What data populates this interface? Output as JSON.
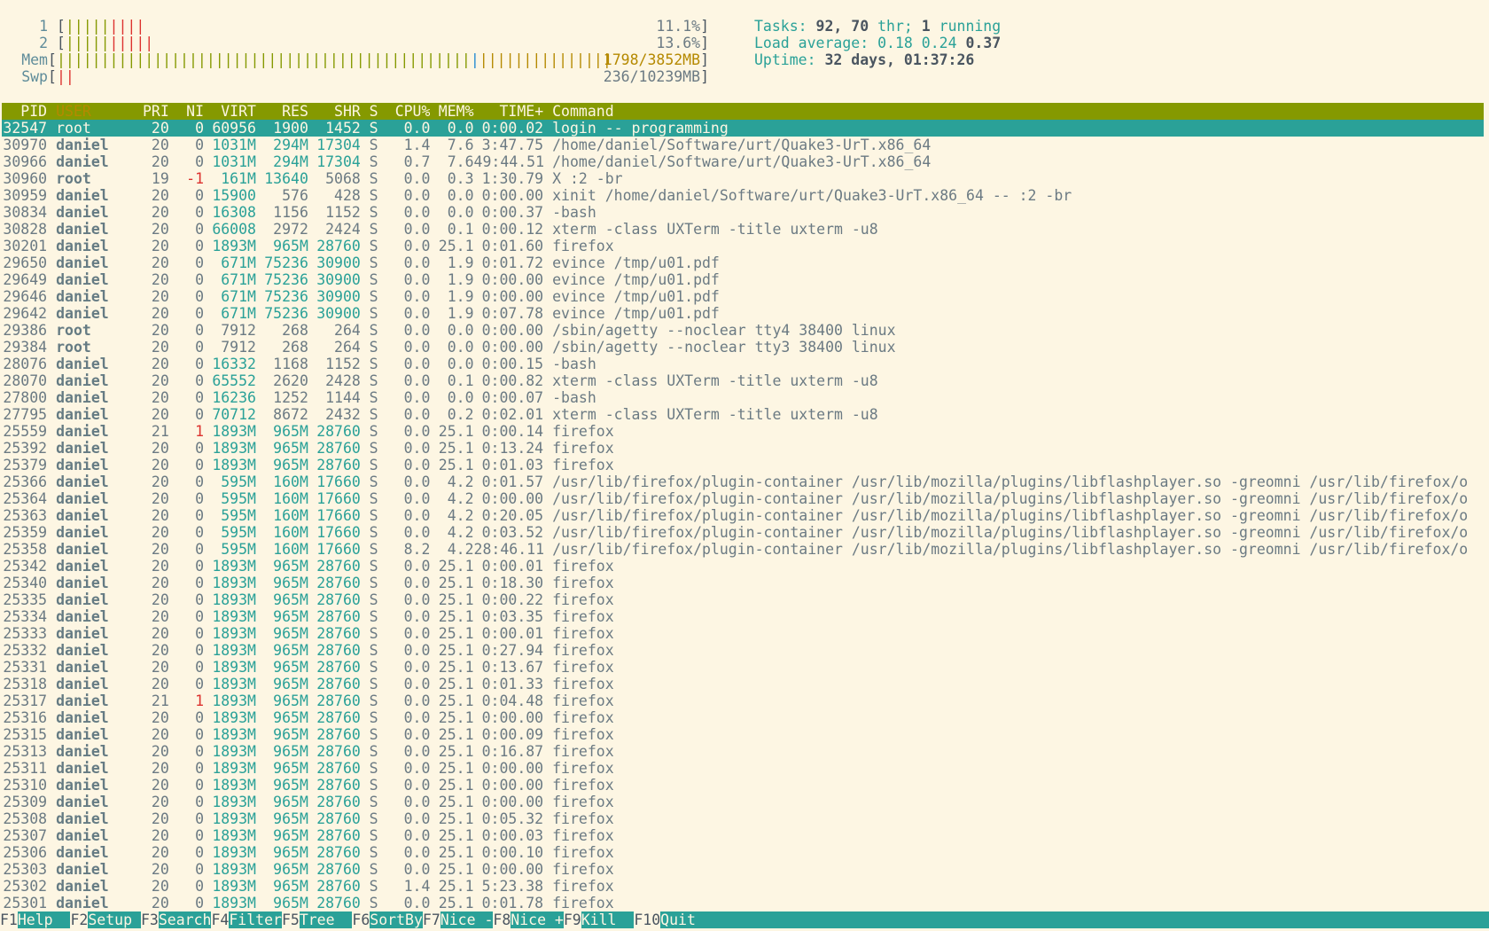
{
  "meters": {
    "cpu1": {
      "label": "1",
      "bars": "|||||||||",
      "value": "11.1%"
    },
    "cpu2": {
      "label": "2",
      "bars": "||||||||||",
      "value": "13.6%"
    },
    "mem": {
      "label": "Mem",
      "value": "1798/3852MB"
    },
    "swp": {
      "label": "Swp",
      "bars": "||",
      "value": "236/10239MB"
    }
  },
  "info": {
    "tasks_label": "Tasks: ",
    "tasks_value": "92, 70",
    "tasks_thr": " thr; ",
    "tasks_running": "1",
    "tasks_running_label": " running",
    "load_label": "Load average: ",
    "load_1": "0.18",
    "load_5": "0.24",
    "load_15": "0.37",
    "uptime_label": "Uptime: ",
    "uptime_value": "32 days, 01:37:26"
  },
  "columns": [
    "PID",
    "USER",
    "PRI",
    "NI",
    "VIRT",
    "RES",
    "SHR",
    "S",
    "CPU%",
    "MEM%",
    "TIME+",
    "Command"
  ],
  "processes": [
    [
      "32547",
      "root",
      "20",
      "0",
      "60956",
      "1900",
      "1452",
      "S",
      "0.0",
      "0.0",
      "0:00.02",
      "login -- programming"
    ],
    [
      "30970",
      "daniel",
      "20",
      "0",
      "1031M",
      "294M",
      "17304",
      "S",
      "1.4",
      "7.6",
      "3:47.75",
      "/home/daniel/Software/urt/Quake3-UrT.x86_64"
    ],
    [
      "30966",
      "daniel",
      "20",
      "0",
      "1031M",
      "294M",
      "17304",
      "S",
      "0.7",
      "7.6",
      "49:44.51",
      "/home/daniel/Software/urt/Quake3-UrT.x86_64"
    ],
    [
      "30960",
      "root",
      "19",
      "-1",
      "161M",
      "13640",
      "5068",
      "S",
      "0.0",
      "0.3",
      "1:30.79",
      "X :2 -br"
    ],
    [
      "30959",
      "daniel",
      "20",
      "0",
      "15900",
      "576",
      "428",
      "S",
      "0.0",
      "0.0",
      "0:00.00",
      "xinit /home/daniel/Software/urt/Quake3-UrT.x86_64 -- :2 -br"
    ],
    [
      "30834",
      "daniel",
      "20",
      "0",
      "16308",
      "1156",
      "1152",
      "S",
      "0.0",
      "0.0",
      "0:00.37",
      "-bash"
    ],
    [
      "30828",
      "daniel",
      "20",
      "0",
      "66008",
      "2972",
      "2424",
      "S",
      "0.0",
      "0.1",
      "0:00.12",
      "xterm -class UXTerm -title uxterm -u8"
    ],
    [
      "30201",
      "daniel",
      "20",
      "0",
      "1893M",
      "965M",
      "28760",
      "S",
      "0.0",
      "25.1",
      "0:01.60",
      "firefox"
    ],
    [
      "29650",
      "daniel",
      "20",
      "0",
      "671M",
      "75236",
      "30900",
      "S",
      "0.0",
      "1.9",
      "0:01.72",
      "evince /tmp/u01.pdf"
    ],
    [
      "29649",
      "daniel",
      "20",
      "0",
      "671M",
      "75236",
      "30900",
      "S",
      "0.0",
      "1.9",
      "0:00.00",
      "evince /tmp/u01.pdf"
    ],
    [
      "29646",
      "daniel",
      "20",
      "0",
      "671M",
      "75236",
      "30900",
      "S",
      "0.0",
      "1.9",
      "0:00.00",
      "evince /tmp/u01.pdf"
    ],
    [
      "29642",
      "daniel",
      "20",
      "0",
      "671M",
      "75236",
      "30900",
      "S",
      "0.0",
      "1.9",
      "0:07.78",
      "evince /tmp/u01.pdf"
    ],
    [
      "29386",
      "root",
      "20",
      "0",
      "7912",
      "268",
      "264",
      "S",
      "0.0",
      "0.0",
      "0:00.00",
      "/sbin/agetty --noclear tty4 38400 linux"
    ],
    [
      "29384",
      "root",
      "20",
      "0",
      "7912",
      "268",
      "264",
      "S",
      "0.0",
      "0.0",
      "0:00.00",
      "/sbin/agetty --noclear tty3 38400 linux"
    ],
    [
      "28076",
      "daniel",
      "20",
      "0",
      "16332",
      "1168",
      "1152",
      "S",
      "0.0",
      "0.0",
      "0:00.15",
      "-bash"
    ],
    [
      "28070",
      "daniel",
      "20",
      "0",
      "65552",
      "2620",
      "2428",
      "S",
      "0.0",
      "0.1",
      "0:00.82",
      "xterm -class UXTerm -title uxterm -u8"
    ],
    [
      "27800",
      "daniel",
      "20",
      "0",
      "16236",
      "1252",
      "1144",
      "S",
      "0.0",
      "0.0",
      "0:00.07",
      "-bash"
    ],
    [
      "27795",
      "daniel",
      "20",
      "0",
      "70712",
      "8672",
      "2432",
      "S",
      "0.0",
      "0.2",
      "0:02.01",
      "xterm -class UXTerm -title uxterm -u8"
    ],
    [
      "25559",
      "daniel",
      "21",
      "1",
      "1893M",
      "965M",
      "28760",
      "S",
      "0.0",
      "25.1",
      "0:00.14",
      "firefox"
    ],
    [
      "25392",
      "daniel",
      "20",
      "0",
      "1893M",
      "965M",
      "28760",
      "S",
      "0.0",
      "25.1",
      "0:13.24",
      "firefox"
    ],
    [
      "25379",
      "daniel",
      "20",
      "0",
      "1893M",
      "965M",
      "28760",
      "S",
      "0.0",
      "25.1",
      "0:01.03",
      "firefox"
    ],
    [
      "25366",
      "daniel",
      "20",
      "0",
      "595M",
      "160M",
      "17660",
      "S",
      "0.0",
      "4.2",
      "0:01.57",
      "/usr/lib/firefox/plugin-container /usr/lib/mozilla/plugins/libflashplayer.so -greomni /usr/lib/firefox/o"
    ],
    [
      "25364",
      "daniel",
      "20",
      "0",
      "595M",
      "160M",
      "17660",
      "S",
      "0.0",
      "4.2",
      "0:00.00",
      "/usr/lib/firefox/plugin-container /usr/lib/mozilla/plugins/libflashplayer.so -greomni /usr/lib/firefox/o"
    ],
    [
      "25363",
      "daniel",
      "20",
      "0",
      "595M",
      "160M",
      "17660",
      "S",
      "0.0",
      "4.2",
      "0:20.05",
      "/usr/lib/firefox/plugin-container /usr/lib/mozilla/plugins/libflashplayer.so -greomni /usr/lib/firefox/o"
    ],
    [
      "25359",
      "daniel",
      "20",
      "0",
      "595M",
      "160M",
      "17660",
      "S",
      "0.0",
      "4.2",
      "0:03.52",
      "/usr/lib/firefox/plugin-container /usr/lib/mozilla/plugins/libflashplayer.so -greomni /usr/lib/firefox/o"
    ],
    [
      "25358",
      "daniel",
      "20",
      "0",
      "595M",
      "160M",
      "17660",
      "S",
      "8.2",
      "4.2",
      "28:46.11",
      "/usr/lib/firefox/plugin-container /usr/lib/mozilla/plugins/libflashplayer.so -greomni /usr/lib/firefox/o"
    ],
    [
      "25342",
      "daniel",
      "20",
      "0",
      "1893M",
      "965M",
      "28760",
      "S",
      "0.0",
      "25.1",
      "0:00.01",
      "firefox"
    ],
    [
      "25340",
      "daniel",
      "20",
      "0",
      "1893M",
      "965M",
      "28760",
      "S",
      "0.0",
      "25.1",
      "0:18.30",
      "firefox"
    ],
    [
      "25335",
      "daniel",
      "20",
      "0",
      "1893M",
      "965M",
      "28760",
      "S",
      "0.0",
      "25.1",
      "0:00.22",
      "firefox"
    ],
    [
      "25334",
      "daniel",
      "20",
      "0",
      "1893M",
      "965M",
      "28760",
      "S",
      "0.0",
      "25.1",
      "0:03.35",
      "firefox"
    ],
    [
      "25333",
      "daniel",
      "20",
      "0",
      "1893M",
      "965M",
      "28760",
      "S",
      "0.0",
      "25.1",
      "0:00.01",
      "firefox"
    ],
    [
      "25332",
      "daniel",
      "20",
      "0",
      "1893M",
      "965M",
      "28760",
      "S",
      "0.0",
      "25.1",
      "0:27.94",
      "firefox"
    ],
    [
      "25331",
      "daniel",
      "20",
      "0",
      "1893M",
      "965M",
      "28760",
      "S",
      "0.0",
      "25.1",
      "0:13.67",
      "firefox"
    ],
    [
      "25318",
      "daniel",
      "20",
      "0",
      "1893M",
      "965M",
      "28760",
      "S",
      "0.0",
      "25.1",
      "0:01.33",
      "firefox"
    ],
    [
      "25317",
      "daniel",
      "21",
      "1",
      "1893M",
      "965M",
      "28760",
      "S",
      "0.0",
      "25.1",
      "0:04.48",
      "firefox"
    ],
    [
      "25316",
      "daniel",
      "20",
      "0",
      "1893M",
      "965M",
      "28760",
      "S",
      "0.0",
      "25.1",
      "0:00.00",
      "firefox"
    ],
    [
      "25315",
      "daniel",
      "20",
      "0",
      "1893M",
      "965M",
      "28760",
      "S",
      "0.0",
      "25.1",
      "0:00.09",
      "firefox"
    ],
    [
      "25313",
      "daniel",
      "20",
      "0",
      "1893M",
      "965M",
      "28760",
      "S",
      "0.0",
      "25.1",
      "0:16.87",
      "firefox"
    ],
    [
      "25311",
      "daniel",
      "20",
      "0",
      "1893M",
      "965M",
      "28760",
      "S",
      "0.0",
      "25.1",
      "0:00.00",
      "firefox"
    ],
    [
      "25310",
      "daniel",
      "20",
      "0",
      "1893M",
      "965M",
      "28760",
      "S",
      "0.0",
      "25.1",
      "0:00.00",
      "firefox"
    ],
    [
      "25309",
      "daniel",
      "20",
      "0",
      "1893M",
      "965M",
      "28760",
      "S",
      "0.0",
      "25.1",
      "0:00.00",
      "firefox"
    ],
    [
      "25308",
      "daniel",
      "20",
      "0",
      "1893M",
      "965M",
      "28760",
      "S",
      "0.0",
      "25.1",
      "0:05.32",
      "firefox"
    ],
    [
      "25307",
      "daniel",
      "20",
      "0",
      "1893M",
      "965M",
      "28760",
      "S",
      "0.0",
      "25.1",
      "0:00.03",
      "firefox"
    ],
    [
      "25306",
      "daniel",
      "20",
      "0",
      "1893M",
      "965M",
      "28760",
      "S",
      "0.0",
      "25.1",
      "0:00.10",
      "firefox"
    ],
    [
      "25303",
      "daniel",
      "20",
      "0",
      "1893M",
      "965M",
      "28760",
      "S",
      "0.0",
      "25.1",
      "0:00.00",
      "firefox"
    ],
    [
      "25302",
      "daniel",
      "20",
      "0",
      "1893M",
      "965M",
      "28760",
      "S",
      "1.4",
      "25.1",
      "5:23.38",
      "firefox"
    ],
    [
      "25301",
      "daniel",
      "20",
      "0",
      "1893M",
      "965M",
      "28760",
      "S",
      "0.0",
      "25.1",
      "0:01.78",
      "firefox"
    ]
  ],
  "selected_row": 0,
  "footer": [
    {
      "key": "F1",
      "label": "Help  "
    },
    {
      "key": "F2",
      "label": "Setup "
    },
    {
      "key": "F3",
      "label": "Search"
    },
    {
      "key": "F4",
      "label": "Filter"
    },
    {
      "key": "F5",
      "label": "Tree  "
    },
    {
      "key": "F6",
      "label": "SortBy"
    },
    {
      "key": "F7",
      "label": "Nice -"
    },
    {
      "key": "F8",
      "label": "Nice +"
    },
    {
      "key": "F9",
      "label": "Kill  "
    },
    {
      "key": "F10",
      "label": "Quit"
    }
  ],
  "colors": {
    "background": "#fdf6e3",
    "header_bar": "#859900",
    "selection": "#2aa198",
    "accent": "#2aa198"
  }
}
